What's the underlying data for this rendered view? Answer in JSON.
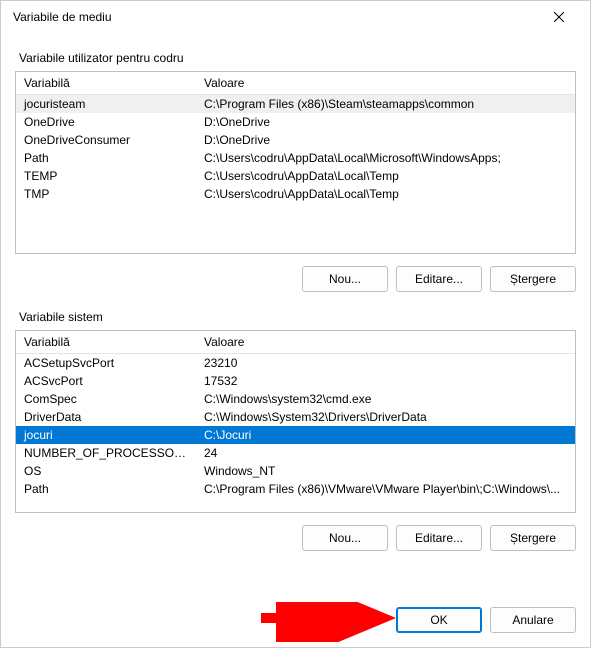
{
  "window": {
    "title": "Variabile de mediu"
  },
  "user_group": {
    "label": "Variabile utilizator pentru codru",
    "headers": {
      "name": "Variabilă",
      "value": "Valoare"
    },
    "rows": [
      {
        "name": "jocuristeam",
        "value": "C:\\Program Files (x86)\\Steam\\steamapps\\common"
      },
      {
        "name": "OneDrive",
        "value": "D:\\OneDrive"
      },
      {
        "name": "OneDriveConsumer",
        "value": "D:\\OneDrive"
      },
      {
        "name": "Path",
        "value": "C:\\Users\\codru\\AppData\\Local\\Microsoft\\WindowsApps;"
      },
      {
        "name": "TEMP",
        "value": "C:\\Users\\codru\\AppData\\Local\\Temp"
      },
      {
        "name": "TMP",
        "value": "C:\\Users\\codru\\AppData\\Local\\Temp"
      }
    ],
    "selected_index": 0,
    "buttons": {
      "new": "Nou...",
      "edit": "Editare...",
      "delete": "Ștergere"
    }
  },
  "system_group": {
    "label": "Variabile sistem",
    "headers": {
      "name": "Variabilă",
      "value": "Valoare"
    },
    "rows": [
      {
        "name": "ACSetupSvcPort",
        "value": "23210"
      },
      {
        "name": "ACSvcPort",
        "value": "17532"
      },
      {
        "name": "ComSpec",
        "value": "C:\\Windows\\system32\\cmd.exe"
      },
      {
        "name": "DriverData",
        "value": "C:\\Windows\\System32\\Drivers\\DriverData"
      },
      {
        "name": "jocuri",
        "value": "C:\\Jocuri"
      },
      {
        "name": "NUMBER_OF_PROCESSORS",
        "value": "24"
      },
      {
        "name": "OS",
        "value": "Windows_NT"
      },
      {
        "name": "Path",
        "value": "C:\\Program Files (x86)\\VMware\\VMware Player\\bin\\;C:\\Windows\\..."
      }
    ],
    "selected_index": 4,
    "buttons": {
      "new": "Nou...",
      "edit": "Editare...",
      "delete": "Ștergere"
    }
  },
  "footer": {
    "ok": "OK",
    "cancel": "Anulare"
  }
}
